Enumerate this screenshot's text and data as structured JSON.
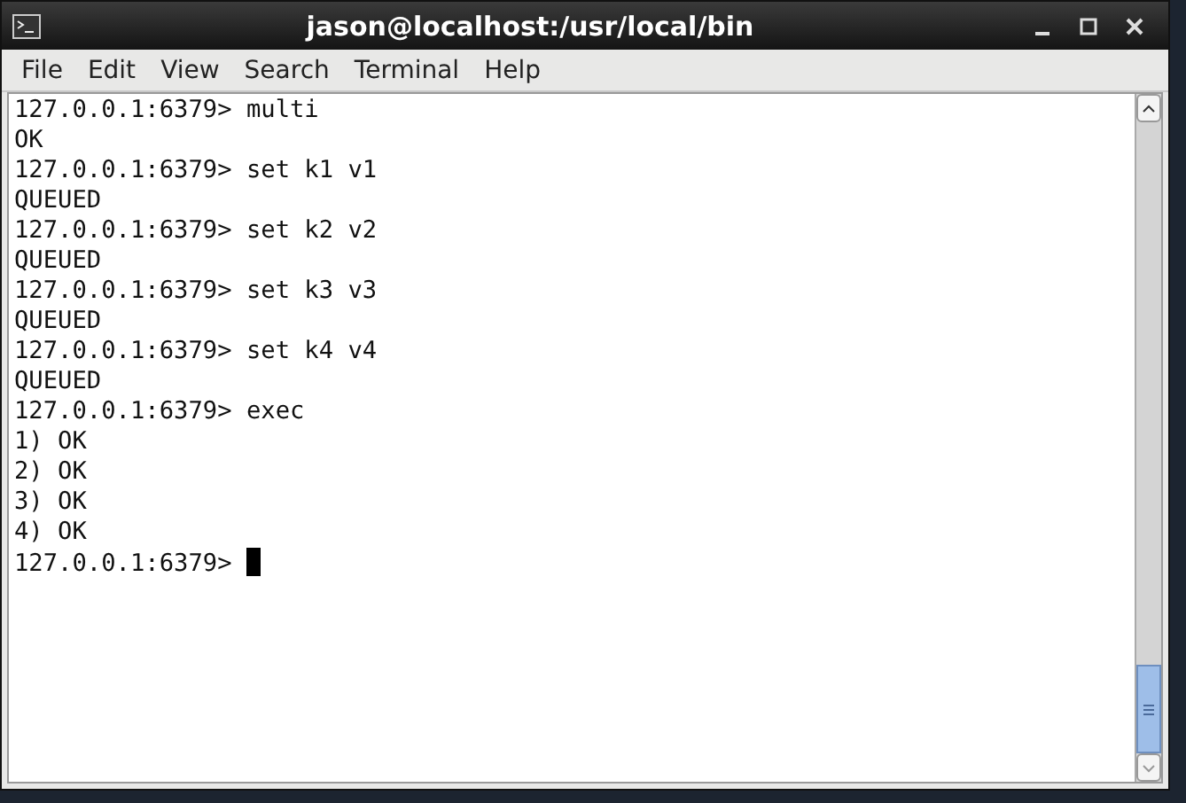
{
  "window": {
    "title": "jason@localhost:/usr/local/bin"
  },
  "menu": [
    "File",
    "Edit",
    "View",
    "Search",
    "Terminal",
    "Help"
  ],
  "terminal": {
    "lines": [
      "127.0.0.1:6379> multi",
      "OK",
      "127.0.0.1:6379> set k1 v1",
      "QUEUED",
      "127.0.0.1:6379> set k2 v2",
      "QUEUED",
      "127.0.0.1:6379> set k3 v3",
      "QUEUED",
      "127.0.0.1:6379> set k4 v4",
      "QUEUED",
      "127.0.0.1:6379> exec",
      "1) OK",
      "2) OK",
      "3) OK",
      "4) OK"
    ],
    "prompt": "127.0.0.1:6379> "
  }
}
